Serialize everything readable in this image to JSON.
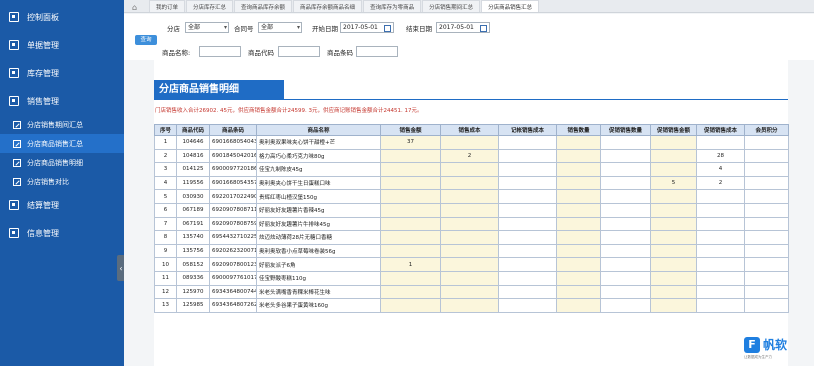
{
  "sidebar": {
    "menu": [
      {
        "label": "控制面板"
      },
      {
        "label": "单据管理"
      },
      {
        "label": "库存管理"
      },
      {
        "label": "销售管理"
      }
    ],
    "sub_items": [
      {
        "label": "分店销售期间汇总"
      },
      {
        "label": "分店商品销售汇总"
      },
      {
        "label": "分店商品销售明细"
      },
      {
        "label": "分店销售对比"
      }
    ],
    "menu2": [
      {
        "label": "结算管理"
      },
      {
        "label": "信息管理"
      }
    ],
    "collapse_glyph": "‹"
  },
  "tabs": [
    "我的订单",
    "分店库存汇总",
    "查询商品库存余额",
    "商品库存余额商品名细",
    "查询库存为零商品",
    "分店销售期间汇总",
    "分店商品销售汇总"
  ],
  "filters": {
    "branch_label": "分店",
    "branch_value": "全部",
    "counter_label": "合同号",
    "counter_value": "全部",
    "start_label": "开始日期",
    "start_value": "2017-05-01",
    "end_label": "结束日期",
    "end_value": "2017-05-01",
    "query_btn": "查询",
    "name_label": "商品名称:",
    "code_label": "商品代码",
    "barcode_label": "商品条码"
  },
  "report": {
    "title": "分店商品销售明细",
    "summary": "门店销售收入合计26902. 45元，供应商销售金额合计24599. 3元，供应商记账销售金额合计24451. 17元。",
    "columns": [
      "序号",
      "商品代码",
      "商品条码",
      "商品名称",
      "销售金额",
      "销售成本",
      "记帐销售成本",
      "销售数量",
      "促销销售数量",
      "促销销售金额",
      "促销销售成本",
      "会员积分"
    ],
    "rows": [
      {
        "no": "1",
        "code": "104646",
        "barcode": "6901668054043",
        "name": "奥利奥双果味夹心饼干甜橙+芒",
        "v": [
          "37",
          "",
          "",
          "",
          "",
          "",
          "",
          ""
        ]
      },
      {
        "no": "2",
        "code": "104816",
        "barcode": "6901845042016",
        "name": "格力高巧心柔巧克力味80g",
        "v": [
          "",
          "2",
          "",
          "",
          "",
          "",
          "28",
          ""
        ]
      },
      {
        "no": "3",
        "code": "014125",
        "barcode": "6900097720186",
        "name": "佳宝九制陈皮45g",
        "v": [
          "",
          "",
          "",
          "",
          "",
          "",
          "4",
          ""
        ]
      },
      {
        "no": "4",
        "code": "119556",
        "barcode": "6901668054357",
        "name": "奥利奥夹心饼干生日蛋糕口味",
        "v": [
          "",
          "",
          "",
          "",
          "",
          "5",
          "2",
          ""
        ]
      },
      {
        "no": "5",
        "code": "030930",
        "barcode": "6922017022490",
        "name": "贵辉红枣山楂汉堡150g",
        "v": [
          "",
          "",
          "",
          "",
          "",
          "",
          "",
          ""
        ]
      },
      {
        "no": "6",
        "code": "067189",
        "barcode": "6920907808711",
        "name": "好丽友好友趣薯片香辣45g",
        "v": [
          "",
          "",
          "",
          "",
          "",
          "",
          "",
          ""
        ]
      },
      {
        "no": "7",
        "code": "067191",
        "barcode": "6920907808759",
        "name": "好丽友好友趣薯片牛排味45g",
        "v": [
          "",
          "",
          "",
          "",
          "",
          "",
          "",
          ""
        ]
      },
      {
        "no": "8",
        "code": "135740",
        "barcode": "6954432710225",
        "name": "炫迈炫动薄荷28片无糖口香糖",
        "v": [
          "",
          "",
          "",
          "",
          "",
          "",
          "",
          ""
        ]
      },
      {
        "no": "9",
        "code": "135756",
        "barcode": "6920262320071",
        "name": "奥利奥软香小点草莓味卷装56g",
        "v": [
          "",
          "",
          "",
          "",
          "",
          "",
          "",
          ""
        ]
      },
      {
        "no": "10",
        "code": "058152",
        "barcode": "6920907800123",
        "name": "好丽友派子6角",
        "v": [
          "1",
          "",
          "",
          "",
          "",
          "",
          "",
          ""
        ]
      },
      {
        "no": "11",
        "code": "089336",
        "barcode": "6900097761017",
        "name": "佳宝野酸枣糕110g",
        "v": [
          "",
          "",
          "",
          "",
          "",
          "",
          "",
          ""
        ]
      },
      {
        "no": "12",
        "code": "125970",
        "barcode": "6934364800744",
        "name": "米老头满嘴香青稞米棒花生味",
        "v": [
          "",
          "",
          "",
          "",
          "",
          "",
          "",
          ""
        ]
      },
      {
        "no": "13",
        "code": "125985",
        "barcode": "6934364807262",
        "name": "米老头多谷果子蛋黄味160g",
        "v": [
          "",
          "",
          "",
          "",
          "",
          "",
          "",
          ""
        ]
      }
    ]
  },
  "logo": {
    "mark": "F",
    "name": "帆软",
    "tagline": "让数据成为生产力"
  }
}
